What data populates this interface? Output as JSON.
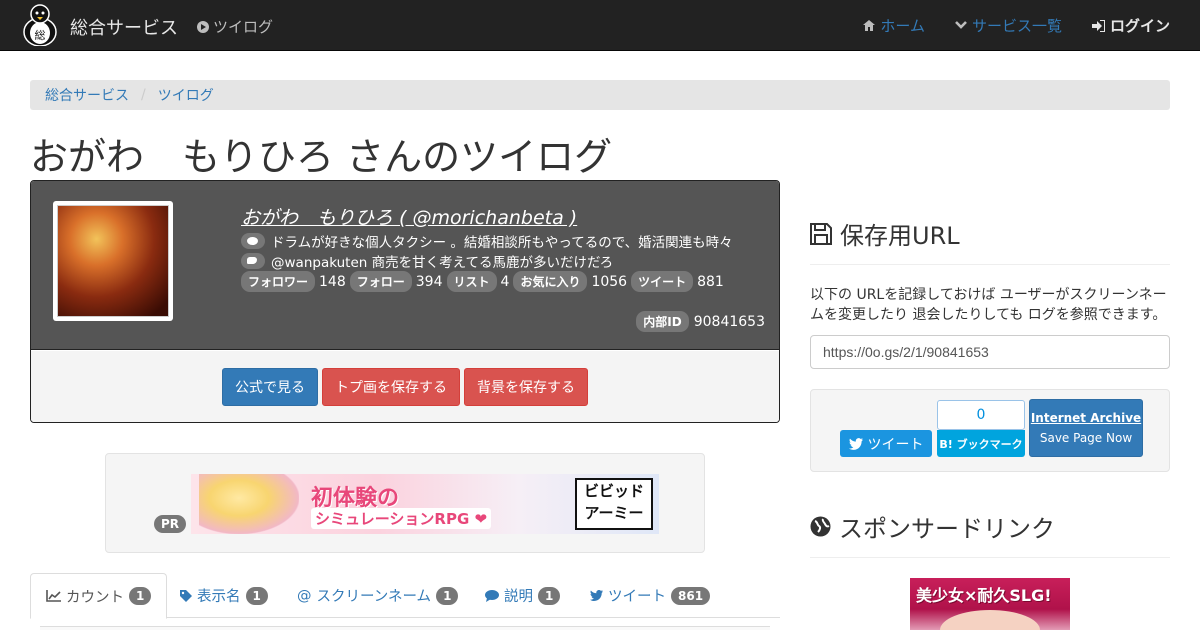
{
  "navbar": {
    "brand": "総合サービス",
    "logo_glyph": "総",
    "sub_link": "ツイログ",
    "home": "ホーム",
    "services": "サービス一覧",
    "login": "ログイン"
  },
  "breadcrumb": {
    "home": "総合サービス",
    "sep": "/",
    "current": "ツイログ"
  },
  "page": {
    "title": "おがわ　もりひろ さんのツイログ"
  },
  "profile": {
    "name_link": "おがわ　もりひろ ( @morichanbeta )",
    "bio": "ドラムが好きな個人タクシー 。結婚相談所もやってるので、婚活関連も時々",
    "latest_tweet": "@wanpakuten 商売を甘く考えてる馬鹿が多いだけだろ",
    "stats": [
      {
        "label": "フォロワー",
        "value": "148"
      },
      {
        "label": "フォロー",
        "value": "394"
      },
      {
        "label": "リスト",
        "value": "4"
      },
      {
        "label": "お気に入り",
        "value": "1056"
      },
      {
        "label": "ツイート",
        "value": "881"
      }
    ],
    "internal_id_label": "内部ID",
    "internal_id": "90841653",
    "buttons": {
      "official": "公式で見る",
      "save_avatar": "トプ画を保存する",
      "save_bg": "背景を保存する"
    }
  },
  "pr": {
    "badge": "PR",
    "banner_line1": "初体験の",
    "banner_line2": "シミュレーションRPG ❤",
    "banner_logo": "ビビッド アーミー"
  },
  "tabs": [
    {
      "label": "カウント",
      "count": "1"
    },
    {
      "label": "表示名",
      "count": "1"
    },
    {
      "label": "スクリーンネーム",
      "count": "1"
    },
    {
      "label": "説明",
      "count": "1"
    },
    {
      "label": "ツイート",
      "count": "861"
    }
  ],
  "side": {
    "save_heading": "保存用URL",
    "save_text": "以下の URLを記録しておけば ユーザーがスクリーンネームを変更したり 退会したりしても ログを参照できます。",
    "url": "https://0o.gs/2/1/90841653",
    "tweet_button": "ツイート",
    "hatena_count": "0",
    "hatena_button": "B! ブックマーク",
    "ia_title": "Internet Archive",
    "ia_sub": "Save Page Now",
    "sponsor_heading": "スポンサードリンク",
    "ad_text": "美少女×耐久SLG!"
  },
  "colors": {
    "navbar": "#222222",
    "primary": "#337ab7",
    "danger": "#d9534f",
    "twitter": "#1b95e0",
    "hatena": "#00a4de"
  }
}
